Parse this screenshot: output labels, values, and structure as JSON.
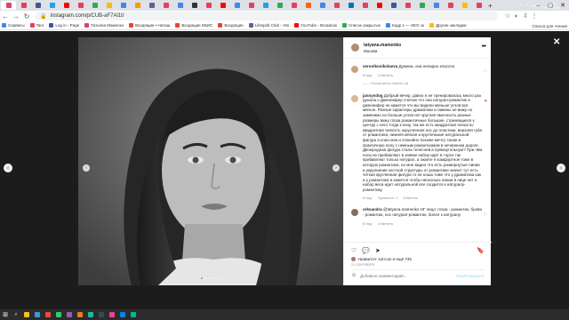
{
  "browser": {
    "tab_favicons": [
      "#e4405f",
      "#e4405f",
      "#3b5998",
      "#1da1f2",
      "#ff0000",
      "#e4405f",
      "#34a853",
      "#fbbc05",
      "#4285f4",
      "#ff9900",
      "#6b5b95",
      "#e4405f",
      "#4285f4",
      "#333333",
      "#e4405f",
      "#ff0000",
      "#4285f4",
      "#e4405f",
      "#1da1f2",
      "#34a853",
      "#e4405f",
      "#ff6600",
      "#4285f4",
      "#e4405f",
      "#0077b5",
      "#e4405f",
      "#ff0000",
      "#3b5998",
      "#e4405f",
      "#34a853",
      "#4285f4",
      "#e4405f",
      "#fbbc05",
      "#e4405f"
    ],
    "new_tab_label": "+",
    "window_controls": [
      "–",
      "▢",
      "✕"
    ],
    "url": "instagram.com/p/CUB-aF7Al1t/",
    "extensions": [
      "☆",
      "◐",
      "⇩",
      "⋮"
    ],
    "bookmarks": [
      {
        "label": "Сервисы",
        "color": "#4285f4"
      },
      {
        "label": "Taro",
        "color": "#e4405f"
      },
      {
        "label": "Log in › Page",
        "color": "#3b5998"
      },
      {
        "label": "Татьяна Мамелко",
        "color": "#e4405f"
      },
      {
        "label": "Входящие • Наташ",
        "color": "#ea4335"
      },
      {
        "label": "Входящие ЕБИС",
        "color": "#ea4335"
      },
      {
        "label": "Входящие",
        "color": "#ea4335"
      },
      {
        "label": "Lifespirit Club – Мо",
        "color": "#6b5b95"
      },
      {
        "label": "YouTube - Broadcas",
        "color": "#ff0000"
      },
      {
        "label": "Список закрытых",
        "color": "#34a853"
      },
      {
        "label": "Кадр 1 — SEO эк",
        "color": "#4285f4"
      },
      {
        "label": "Другие закладки",
        "color": "#fbbc05"
      }
    ],
    "reading_list": "Список для чтения"
  },
  "post": {
    "username": "tatyana.mamenko",
    "location": "Москва",
    "comments": [
      {
        "username": "veronikonikolaeva",
        "text": "Дужина, она неладно классно",
        "avatar_color": "#c9a27e",
        "time": "8 нед.",
        "reply": "Ответить",
        "replies": "—— Посмотреть ответы (4)"
      },
      {
        "username": "jannysdog",
        "text": "Добрый вечер, давно я не тренировалась много раз дунала о Дженнифер считаю что она натурал-романтик и дженнифер не кажется что вы видели меньше углов все мягкое. Разные характеры драматики и гамины не вижу но заменимо но больше углов нет круглая ямочность разные размеры вижу глаза романтичные большие, стремящиеся к центру с него тогда к низу, так же есть квадратная челюсть/квадратная челюсть округленная нос до пластики, верхняя губа от романтика, нижняя мягкая и кругленькие натуральной фигура а классная и спокойно похоже мечту талии и практичную полу с нежным романтизмом в нечаянном дороге. Двоюродная фигура стала телесней в прямоугольную? При чём носи не прибавляют в заявке набор идет в торсе так прибавляют только натурал, а знаете я комфортное тоже в которую романтика, но мне видно что есть развернутые линии и укрупнение костной структуры от романтики значит тут есть четкая кругленная фигура то не ноша тоже что у драматика как и у романтика а кажется чтобы несколько линии в лице нет и набор веса идет натуральной все сходится к натуралу-романтику",
        "avatar_color": "#d9b79a",
        "time": "8 нед.",
        "likes": "Нравится: 1",
        "reply": "Ответить"
      },
      {
        "username": "orksandra",
        "text": "@tatyana.mamenko НГ лицо: глаза - романтик, брови - романтик, нос натурал-романтик, более к натуралу",
        "avatar_color": "#8a6a5a",
        "time": "8 нед.",
        "reply": "Ответить"
      }
    ],
    "more_comments": "Ответить",
    "actions": [
      "♡",
      "💬",
      "➤",
      "🔖"
    ],
    "likes_text": "Нравится: sol.icus и ещё 745",
    "date": "21 СЕНТЯБРЯ",
    "comment_placeholder": "Добавьте комментарий...",
    "publish_label": "Опубликовать"
  },
  "overlay": {
    "close": "✕",
    "prev": "‹",
    "next": "›"
  },
  "taskbar": {
    "start_icon": "⊞",
    "search_icon": "⌕",
    "apps": [
      "#f1c40f",
      "#3498db",
      "#e74c3c",
      "#2ecc71",
      "#9b59b6",
      "#e67e22",
      "#1abc9c",
      "#34495e",
      "#e84393",
      "#0984e3",
      "#00b894"
    ],
    "language": "РУС",
    "time": "21:26",
    "date": "09.11.2021"
  }
}
